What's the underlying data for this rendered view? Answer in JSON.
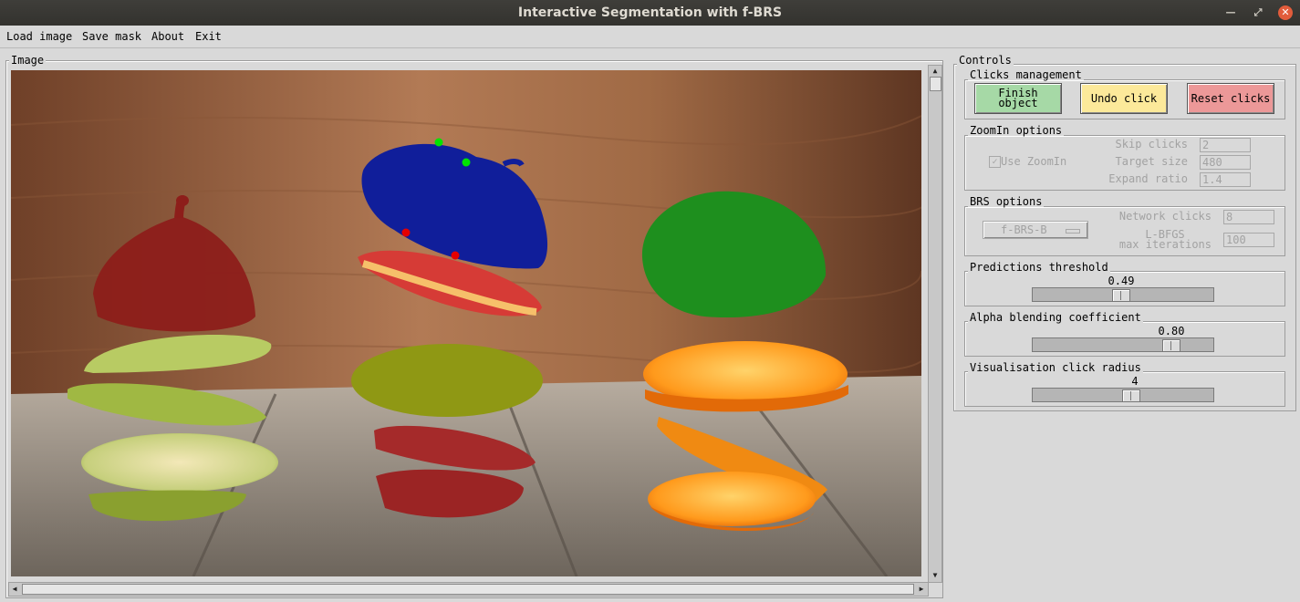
{
  "window": {
    "title": "Interactive Segmentation with f-BRS"
  },
  "menu": [
    "Load image",
    "Save mask",
    "About",
    "Exit"
  ],
  "image_panel": {
    "label": "Image"
  },
  "controls": {
    "label": "Controls",
    "clicks": {
      "label": "Clicks management",
      "finish_line1": "Finish",
      "finish_line2": "object",
      "undo": "Undo click",
      "reset": "Reset clicks"
    },
    "zoomin": {
      "label": "ZoomIn options",
      "use_zoomin": "Use ZoomIn",
      "skip_clicks_label": "Skip clicks",
      "skip_clicks": "2",
      "target_size_label": "Target size",
      "target_size": "480",
      "expand_ratio_label": "Expand ratio",
      "expand_ratio": "1.4"
    },
    "brs": {
      "label": "BRS options",
      "mode": "f-BRS-B",
      "network_clicks_label": "Network clicks",
      "network_clicks": "8",
      "lbfgs_label1": "L-BFGS",
      "lbfgs_label2": "max iterations",
      "lbfgs_iters": "100"
    },
    "threshold": {
      "label": "Predictions threshold",
      "value": "0.49",
      "level": 0.49
    },
    "alpha": {
      "label": "Alpha blending coefficient",
      "value": "0.80",
      "level": 0.8
    },
    "radius": {
      "label": "Visualisation click radius",
      "value": "4",
      "level": 0.55
    }
  },
  "colors": {
    "finish": "#a6d9a6",
    "undo": "#fce99a",
    "reset": "#ec9898",
    "mask_blue": "#101e9a",
    "mask_green": "#1e8f1e",
    "mask_red": "#8d1e1a",
    "mask_olive": "#8f9814",
    "click_positive": "#00e400",
    "click_negative": "#e40000"
  }
}
